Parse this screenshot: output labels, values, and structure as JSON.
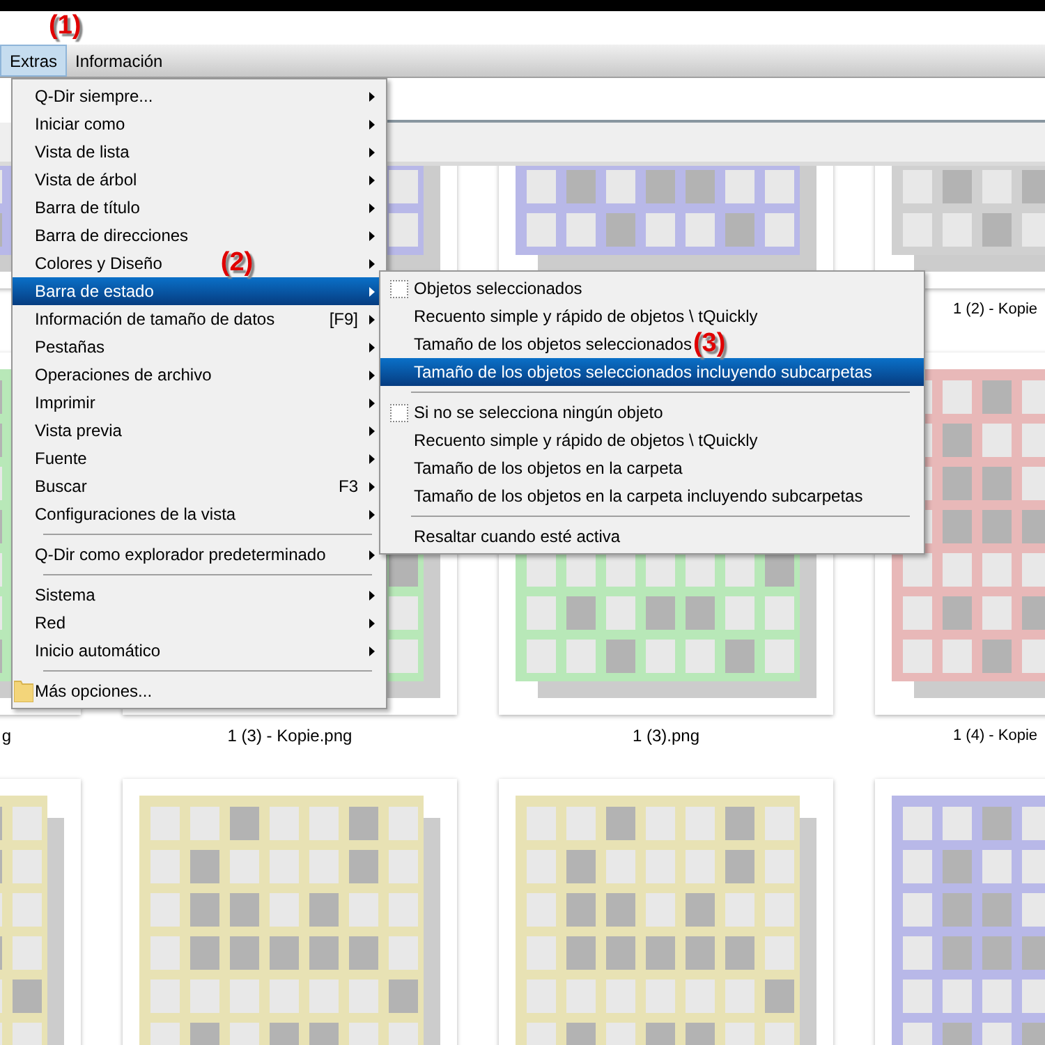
{
  "annotations": [
    {
      "text": "(1)"
    }
  ],
  "menubar": [
    {
      "label": "Extras",
      "selected": true
    },
    {
      "label": "Información",
      "selected": false
    }
  ],
  "thumbnails": [
    {
      "color": "#b8b8e8"
    },
    {
      "color": "#b8b8e8"
    },
    {
      "color": "#b8b8e8"
    },
    {
      "color": "#d0d0d0",
      "label": "1 (2) - Kopie"
    },
    {
      "color": "#b8e8b8",
      "label": "g"
    },
    {
      "color": "#b8e8b8",
      "label": "1 (3) - Kopie.png"
    },
    {
      "color": "#b8e8b8",
      "label": "1 (3).png"
    },
    {
      "color": "#e8b8b8",
      "label": "1 (4) - Kopie"
    },
    {
      "color": "#e8e2b4"
    },
    {
      "color": "#e8e2b4"
    },
    {
      "color": "#e8e2b4"
    },
    {
      "color": "#b8b8e8"
    }
  ],
  "menu": {
    "items": [
      {
        "kind": "item",
        "label": "Q-Dir siempre...",
        "submenu": true,
        "selected": false
      },
      {
        "kind": "item",
        "label": "Iniciar como",
        "submenu": true,
        "selected": false
      },
      {
        "kind": "item",
        "label": "Vista de lista",
        "submenu": true,
        "selected": false
      },
      {
        "kind": "item",
        "label": "Vista de árbol",
        "submenu": true,
        "selected": false
      },
      {
        "kind": "item",
        "label": "Barra de título",
        "submenu": true,
        "selected": false
      },
      {
        "kind": "item",
        "label": "Barra de direcciones",
        "submenu": true,
        "selected": false
      },
      {
        "kind": "item",
        "label": "Colores y Diseño",
        "submenu": true,
        "selected": false,
        "marker": "(2)"
      },
      {
        "kind": "item",
        "label": "Barra de estado",
        "submenu": true,
        "selected": true
      },
      {
        "kind": "item",
        "label": "Información de tamaño de datos",
        "shortcut": "[F9]",
        "submenu": true,
        "selected": false
      },
      {
        "kind": "item",
        "label": "Pestañas",
        "submenu": true,
        "selected": false
      },
      {
        "kind": "item",
        "label": "Operaciones de archivo",
        "submenu": true,
        "selected": false
      },
      {
        "kind": "item",
        "label": "Imprimir",
        "submenu": true,
        "selected": false
      },
      {
        "kind": "item",
        "label": "Vista previa",
        "submenu": true,
        "selected": false
      },
      {
        "kind": "item",
        "label": "Fuente",
        "submenu": true,
        "selected": false
      },
      {
        "kind": "item",
        "label": "Buscar",
        "shortcut": "F3",
        "submenu": true,
        "selected": false
      },
      {
        "kind": "item",
        "label": "Configuraciones de la vista",
        "submenu": true,
        "selected": false
      },
      {
        "kind": "separator"
      },
      {
        "kind": "item",
        "label": "Q-Dir como explorador predeterminado",
        "submenu": true,
        "selected": false
      },
      {
        "kind": "separator"
      },
      {
        "kind": "item",
        "label": "Sistema",
        "submenu": true,
        "selected": false
      },
      {
        "kind": "item",
        "label": "Red",
        "submenu": true,
        "selected": false
      },
      {
        "kind": "item",
        "label": "Inicio automático",
        "submenu": true,
        "selected": false
      },
      {
        "kind": "separator"
      },
      {
        "kind": "folder",
        "label": "Más opciones...",
        "submenu": false,
        "selected": false
      }
    ]
  },
  "submenu": {
    "items": [
      {
        "kind": "check",
        "label": "Objetos seleccionados",
        "checked": false,
        "selected": false
      },
      {
        "kind": "item",
        "label": "Recuento simple y rápido de objetos \\ tQuickly",
        "selected": false
      },
      {
        "kind": "item",
        "label": "Tamaño de los objetos seleccionados",
        "selected": false,
        "marker": "(3)"
      },
      {
        "kind": "item",
        "label": "Tamaño de los objetos seleccionados incluyendo subcarpetas",
        "selected": true
      },
      {
        "kind": "separator"
      },
      {
        "kind": "check",
        "label": "Si no se selecciona ningún objeto",
        "checked": false,
        "selected": false
      },
      {
        "kind": "item",
        "label": "Recuento simple y rápido de objetos \\ tQuickly",
        "selected": false
      },
      {
        "kind": "item",
        "label": "Tamaño de los objetos en la carpeta",
        "selected": false
      },
      {
        "kind": "item",
        "label": "Tamaño de los objetos en la carpeta incluyendo subcarpetas",
        "selected": false
      },
      {
        "kind": "separator"
      },
      {
        "kind": "item",
        "label": "Resaltar cuando esté activa",
        "selected": false
      }
    ]
  }
}
